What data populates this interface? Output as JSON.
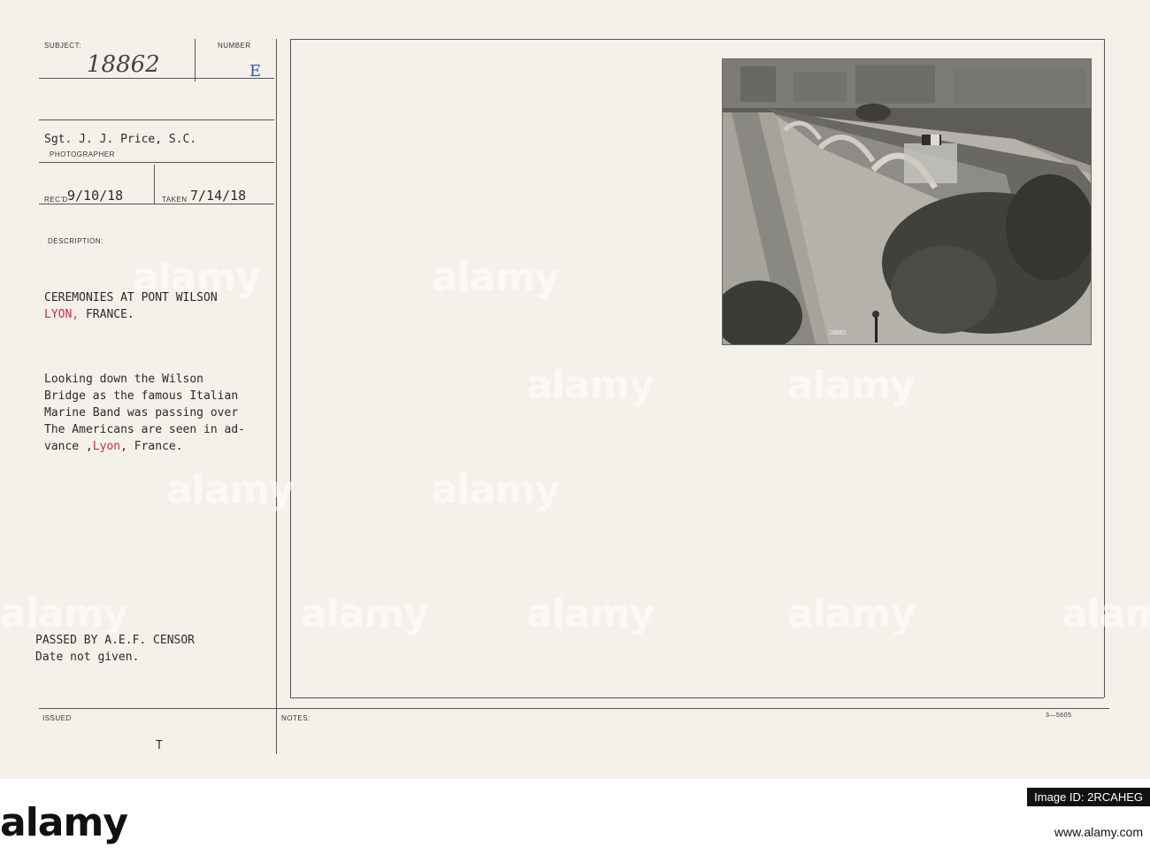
{
  "card": {
    "subject_label": "SUBJECT:",
    "subject_value": "18862",
    "number_label": "NUMBER",
    "number_value": "E",
    "photographer_name": "Sgt. J. J. Price, S.C.",
    "photographer_label": "PHOTOGRAPHER",
    "recd_label": "REC'D",
    "recd_value": "9/10/18",
    "taken_label": "TAKEN",
    "taken_value": "7/14/18",
    "description_label": "DESCRIPTION:",
    "title_line1": "CEREMONIES AT PONT WILSON",
    "title_line2_red": "LYON,",
    "title_line2_rest": " FRANCE.",
    "body_lines": [
      "Looking down the Wilson",
      "Bridge as the famous Italian",
      "Marine Band was passing over",
      "The Americans are seen in ad-"
    ],
    "body_last_prefix": "vance ,",
    "body_last_red": "Lyon",
    "body_last_suffix": ", France.",
    "censor_line1": "PASSED BY A.E.F. CENSOR",
    "censor_line2": "Date not given.",
    "issued_label": "ISSUED",
    "issued_mark": "T",
    "notes_label": "NOTES:",
    "form_number": "3—5605",
    "photo_caption": "18862"
  },
  "watermark": {
    "text": "alamy"
  },
  "branding": {
    "logo_text": "alamy",
    "image_id": "Image ID: 2RCAHEG",
    "url": "www.alamy.com"
  }
}
